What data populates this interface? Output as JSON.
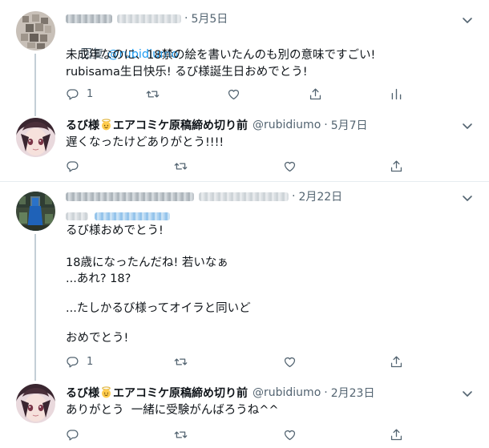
{
  "tweets": [
    {
      "date": "5月5日",
      "reply_prefix": "回复 ",
      "reply_mention": "@rubidiumo",
      "lines": [
        "未成年なのに、18禁の絵を書いたんのも別の意味ですごい!",
        "rubisama生日快乐! るび様誕生日おめでとう!"
      ],
      "reply_count": "1"
    },
    {
      "name_part1": "るび様",
      "name_part2": "エアコミケ原稿締め切り前",
      "handle": "@rubidiumo",
      "date": "5月7日",
      "lines": [
        "遅くなったけどありがとう!!!!"
      ]
    },
    {
      "date": "2月22日",
      "lines": [
        "るび様おめでとう!",
        "",
        "18歳になったんだね! 若いなぁ",
        "...あれ? 18?",
        "",
        "...たしかるび様ってオイラと同いど",
        "",
        "おめでとう!"
      ],
      "reply_count": "1"
    },
    {
      "name_part1": "るび様",
      "name_part2": "エアコミケ原稿締め切り前",
      "handle": "@rubidiumo",
      "date": "2月23日",
      "lines": [
        "ありがとう  一緒に受験がんばろうね^^"
      ]
    }
  ],
  "separator": "·",
  "icons": {
    "reply": "reply-icon",
    "retweet": "retweet-icon",
    "like": "heart-icon",
    "share": "share-icon",
    "analytics": "analytics-icon",
    "more": "chevron-down-icon",
    "angel": "angel-emoji-icon"
  },
  "colors": {
    "accent": "#1d9bf0",
    "secondary_text": "#536471",
    "thread_line": "#c4cfd6",
    "divider": "#e6ecf0"
  }
}
